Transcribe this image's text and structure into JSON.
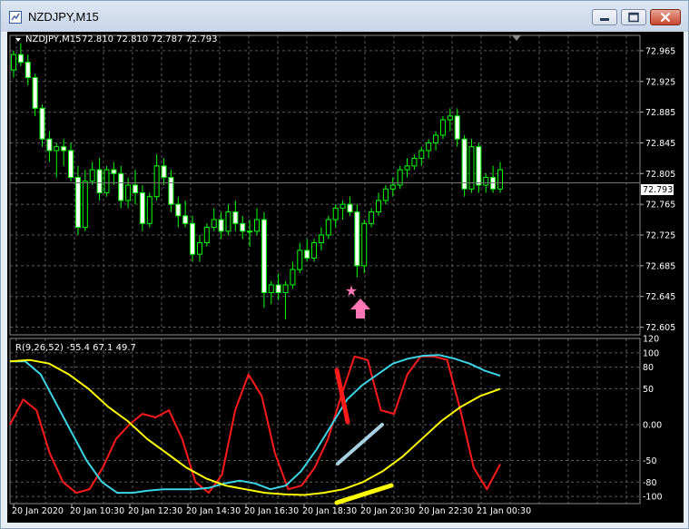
{
  "window": {
    "title": "NZDJPY,M15",
    "controls": [
      "minimize",
      "maximize",
      "close"
    ]
  },
  "price_panel": {
    "symbol_label": "NZDJPY,M15",
    "ohlc_text": "72.810 72.810 72.787 72.793",
    "current_price": "72.793",
    "y_ticks": [
      "72.965",
      "72.925",
      "72.885",
      "72.845",
      "72.805",
      "72.765",
      "72.725",
      "72.685",
      "72.645",
      "72.605"
    ],
    "markers": [
      "star-icon",
      "up-arrow-icon"
    ]
  },
  "indicator_panel": {
    "label": "R(9,26,52) -55.4 67.1 49.7",
    "y_ticks": [
      "120",
      "100",
      "80",
      "50",
      "0.00",
      "-50",
      "-80",
      "-100"
    ]
  },
  "time_axis": [
    "20 Jan 2020",
    "20 Jan 10:30",
    "20 Jan 12:30",
    "20 Jan 14:30",
    "20 Jan 16:30",
    "20 Jan 18:30",
    "20 Jan 20:30",
    "20 Jan 22:30",
    "21 Jan 00:30"
  ],
  "chart_data": [
    {
      "type": "candlestick",
      "title": "NZDJPY,M15",
      "ylim": [
        72.595,
        72.985
      ],
      "current_price": 72.793,
      "x": [
        "20 Jan 2020",
        "20 Jan 10:30",
        "20 Jan 12:30",
        "20 Jan 14:30",
        "20 Jan 16:30",
        "20 Jan 18:30",
        "20 Jan 20:30",
        "20 Jan 22:30",
        "21 Jan 00:30"
      ],
      "candles": [
        [
          72.94,
          72.965,
          72.93,
          72.96
        ],
        [
          72.96,
          72.975,
          72.945,
          72.95
        ],
        [
          72.95,
          72.96,
          72.92,
          72.93
        ],
        [
          72.93,
          72.935,
          72.88,
          72.89
        ],
        [
          72.89,
          72.895,
          72.84,
          72.85
        ],
        [
          72.85,
          72.86,
          72.82,
          72.835
        ],
        [
          72.835,
          72.845,
          72.8,
          72.84
        ],
        [
          72.84,
          72.85,
          72.815,
          72.835
        ],
        [
          72.835,
          72.845,
          72.795,
          72.8
        ],
        [
          72.8,
          72.815,
          72.725,
          72.735
        ],
        [
          72.735,
          72.81,
          72.73,
          72.795
        ],
        [
          72.795,
          72.82,
          72.79,
          72.81
        ],
        [
          72.81,
          72.825,
          72.77,
          72.78
        ],
        [
          72.78,
          72.815,
          72.775,
          72.81
        ],
        [
          72.81,
          72.82,
          72.79,
          72.805
        ],
        [
          72.805,
          72.815,
          72.76,
          72.77
        ],
        [
          72.77,
          72.8,
          72.76,
          72.79
        ],
        [
          72.79,
          72.81,
          72.765,
          72.78
        ],
        [
          72.78,
          72.79,
          72.73,
          72.74
        ],
        [
          72.74,
          72.78,
          72.735,
          72.775
        ],
        [
          72.775,
          72.83,
          72.77,
          72.815
        ],
        [
          72.815,
          72.825,
          72.79,
          72.8
        ],
        [
          72.8,
          72.81,
          72.755,
          72.765
        ],
        [
          72.765,
          72.775,
          72.735,
          72.75
        ],
        [
          72.75,
          72.77,
          72.735,
          72.74
        ],
        [
          72.74,
          72.75,
          72.69,
          72.7
        ],
        [
          72.7,
          72.725,
          72.69,
          72.715
        ],
        [
          72.715,
          72.74,
          72.71,
          72.735
        ],
        [
          72.735,
          72.76,
          72.73,
          72.745
        ],
        [
          72.745,
          72.755,
          72.72,
          72.73
        ],
        [
          72.73,
          72.765,
          72.725,
          72.755
        ],
        [
          72.755,
          72.77,
          72.73,
          72.74
        ],
        [
          72.74,
          72.75,
          72.72,
          72.73
        ],
        [
          72.73,
          72.745,
          72.71,
          72.73
        ],
        [
          72.73,
          72.76,
          72.725,
          72.745
        ],
        [
          72.745,
          72.755,
          72.63,
          72.65
        ],
        [
          72.65,
          72.665,
          72.635,
          72.66
        ],
        [
          72.66,
          72.675,
          72.64,
          72.65
        ],
        [
          72.65,
          72.665,
          72.615,
          72.66
        ],
        [
          72.66,
          72.69,
          72.655,
          72.68
        ],
        [
          72.68,
          72.715,
          72.675,
          72.705
        ],
        [
          72.705,
          72.72,
          72.69,
          72.695
        ],
        [
          72.695,
          72.72,
          72.69,
          72.715
        ],
        [
          72.715,
          72.735,
          72.705,
          72.725
        ],
        [
          72.725,
          72.75,
          72.72,
          72.745
        ],
        [
          72.745,
          72.765,
          72.735,
          72.76
        ],
        [
          72.76,
          72.77,
          72.745,
          72.765
        ],
        [
          72.765,
          72.775,
          72.75,
          72.755
        ],
        [
          72.755,
          72.765,
          72.67,
          72.685
        ],
        [
          72.685,
          72.745,
          72.675,
          72.74
        ],
        [
          72.74,
          72.76,
          72.735,
          72.755
        ],
        [
          72.755,
          72.78,
          72.75,
          72.77
        ],
        [
          72.77,
          72.79,
          72.765,
          72.785
        ],
        [
          72.785,
          72.8,
          72.775,
          72.79
        ],
        [
          72.79,
          72.815,
          72.785,
          72.81
        ],
        [
          72.81,
          72.825,
          72.8,
          72.815
        ],
        [
          72.815,
          72.83,
          72.81,
          72.825
        ],
        [
          72.825,
          72.84,
          72.815,
          72.835
        ],
        [
          72.835,
          72.85,
          72.825,
          72.845
        ],
        [
          72.845,
          72.86,
          72.835,
          72.855
        ],
        [
          72.855,
          72.88,
          72.85,
          72.875
        ],
        [
          72.875,
          72.89,
          72.86,
          72.88
        ],
        [
          72.88,
          72.89,
          72.84,
          72.85
        ],
        [
          72.85,
          72.855,
          72.775,
          72.785
        ],
        [
          72.785,
          72.85,
          72.78,
          72.84
        ],
        [
          72.84,
          72.845,
          72.78,
          72.79
        ],
        [
          72.79,
          72.805,
          72.78,
          72.8
        ],
        [
          72.8,
          72.815,
          72.78,
          72.785
        ],
        [
          72.785,
          72.82,
          72.78,
          72.81
        ]
      ]
    },
    {
      "type": "line",
      "title": "R(9,26,52)",
      "ylim": [
        -110,
        120
      ],
      "series": [
        {
          "name": "",
          "color": "#ff1a1a",
          "values": [
            0,
            35,
            20,
            -40,
            -80,
            -95,
            -90,
            -60,
            -20,
            0,
            15,
            10,
            20,
            -20,
            -80,
            -95,
            -70,
            20,
            70,
            40,
            -40,
            -90,
            -85,
            -60,
            -20,
            40,
            95,
            90,
            20,
            15,
            70,
            95,
            95,
            90,
            20,
            -60,
            -90,
            -55
          ]
        },
        {
          "name": "",
          "color": "#3cd5e6",
          "values": [
            88,
            88,
            70,
            30,
            -10,
            -50,
            -80,
            -95,
            -95,
            -92,
            -90,
            -90,
            -90,
            -88,
            -82,
            -78,
            -82,
            -90,
            -85,
            -65,
            -35,
            0,
            35,
            55,
            70,
            85,
            92,
            96,
            97,
            92,
            85,
            75,
            68
          ]
        },
        {
          "name": "",
          "color": "#ffff00",
          "values": [
            88,
            90,
            85,
            70,
            50,
            25,
            5,
            -20,
            -40,
            -60,
            -75,
            -85,
            -90,
            -95,
            -97,
            -98,
            -95,
            -90,
            -80,
            -65,
            -45,
            -20,
            5,
            25,
            40,
            49.7
          ]
        }
      ],
      "annotations": [
        {
          "label": "red-trend-stroke",
          "color": "#ff1a1a"
        },
        {
          "label": "cyan-trend-stroke",
          "color": "#a8d0e0"
        },
        {
          "label": "yellow-trend-stroke",
          "color": "#ffff00"
        }
      ]
    }
  ],
  "colors": {
    "bull_candle": "#00ff00",
    "bear_candle": "#ffffff",
    "grid": "#5a5a5a",
    "marker": "#ff77b4"
  }
}
